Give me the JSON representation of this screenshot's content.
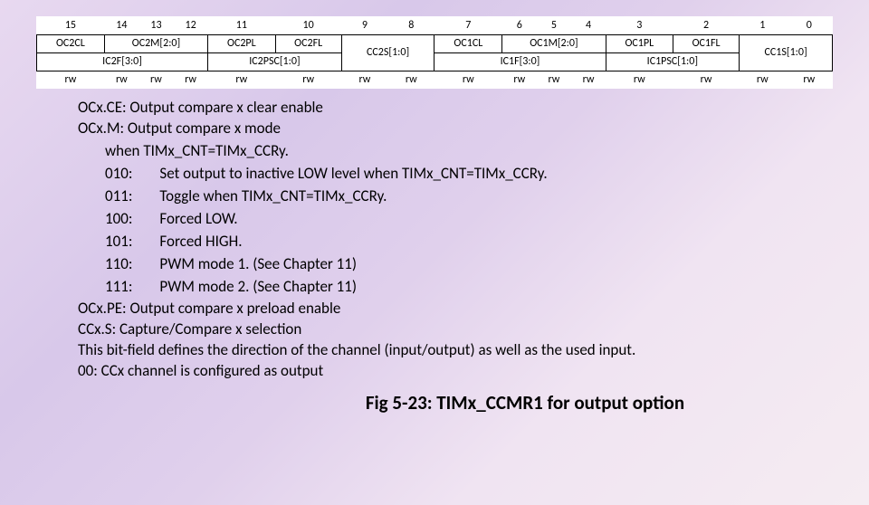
{
  "bits": [
    "15",
    "14",
    "13",
    "12",
    "11",
    "10",
    "9",
    "8",
    "7",
    "6",
    "5",
    "4",
    "3",
    "2",
    "1",
    "0"
  ],
  "row1": {
    "c0": "OC2CL",
    "c1": "OC2M[2:0]",
    "c2": "OC2PL",
    "c3": "OC2FL",
    "c4": "CC2S[1:0]",
    "c5": "OC1CL",
    "c6": "OC1M[2:0]",
    "c7": "OC1PL",
    "c8": "OC1FL",
    "c9": "CC1S[1:0]"
  },
  "row2": {
    "c0": "IC2F[3:0]",
    "c1": "IC2PSC[1:0]",
    "c2": "IC1F[3:0]",
    "c3": "IC1PSC[1:0]"
  },
  "rw": [
    "rw",
    "rw",
    "rw",
    "rw",
    "rw",
    "rw",
    "rw",
    "rw",
    "rw",
    "rw",
    "rw",
    "rw",
    "rw",
    "rw",
    "rw",
    "rw"
  ],
  "defs": {
    "line1": "OCx.CE: Output compare x clear enable",
    "line2": "OCx.M: Output compare x mode",
    "when": "when TIMx_CNT=TIMx_CCRy.",
    "modes": [
      {
        "code": "010:",
        "desc": "Set output to inactive LOW level when TIMx_CNT=TIMx_CCRy."
      },
      {
        "code": "011:",
        "desc": "Toggle when TIMx_CNT=TIMx_CCRy."
      },
      {
        "code": "100:",
        "desc": "Forced LOW."
      },
      {
        "code": "101:",
        "desc": "Forced HIGH."
      },
      {
        "code": "110:",
        "desc": "PWM mode 1.  (See Chapter 11)"
      },
      {
        "code": "111:",
        "desc": "PWM mode 2. (See Chapter 11)"
      }
    ],
    "line3": "OCx.PE: Output compare x preload enable",
    "line4": "CCx.S: Capture/Compare x selection",
    "line5": "This bit-field defines the direction of the channel (input/output) as well as the used input.",
    "line6": "00: CCx channel is configured as output"
  },
  "caption": "Fig 5-23: TIMx_CCMR1 for output option"
}
